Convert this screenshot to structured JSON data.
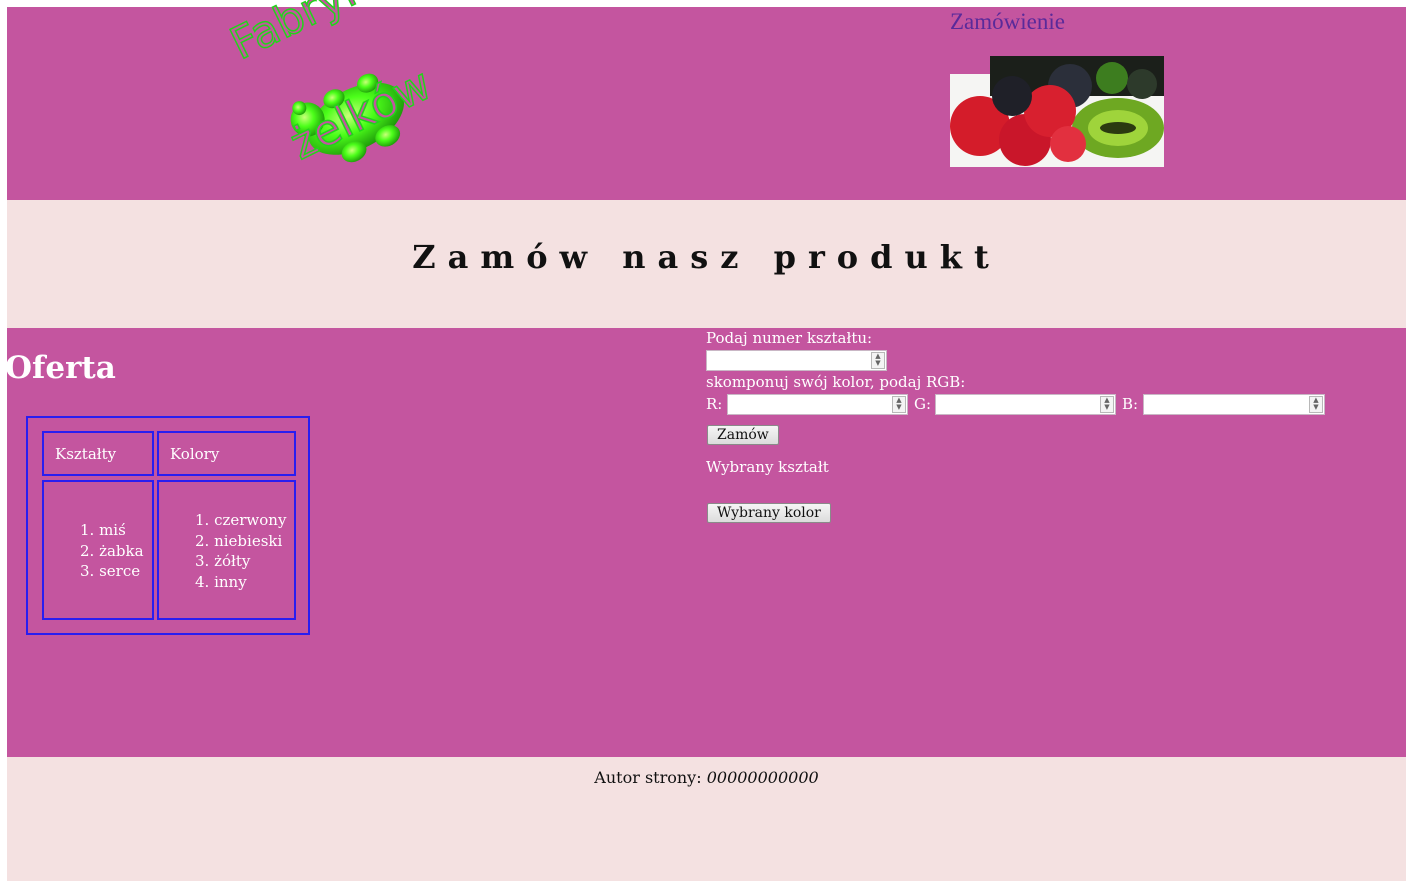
{
  "header": {
    "logo_line1": "Fabryka",
    "logo_line2": "żelków",
    "order_link": "Zamówienie",
    "order_image_alt": "Zamówienie"
  },
  "title": "Zamów nasz produkt",
  "offer": {
    "heading": "Oferta",
    "columns": [
      "Kształty",
      "Kolory"
    ],
    "shapes": [
      "1. miś",
      "2. żabka",
      "3. serce"
    ],
    "colors": [
      "1. czerwony",
      "2. niebieski",
      "3. żółty",
      "4. inny"
    ]
  },
  "form": {
    "shape_label": "Podaj numer kształtu:",
    "rgb_label": "skomponuj swój kolor, podaj RGB:",
    "r_label": "R:",
    "g_label": "G:",
    "b_label": "B:",
    "order_button": "Zamów",
    "selected_shape": "Wybrany kształt",
    "selected_color_button": "Wybrany kolor"
  },
  "footer": {
    "author_label": "Autor strony:",
    "author_name": "00000000000"
  },
  "colors": {
    "magenta": "#c4559f",
    "pale_pink": "#f4e1e1",
    "logo_green": "#22d41b",
    "table_border": "#2a1df0"
  }
}
